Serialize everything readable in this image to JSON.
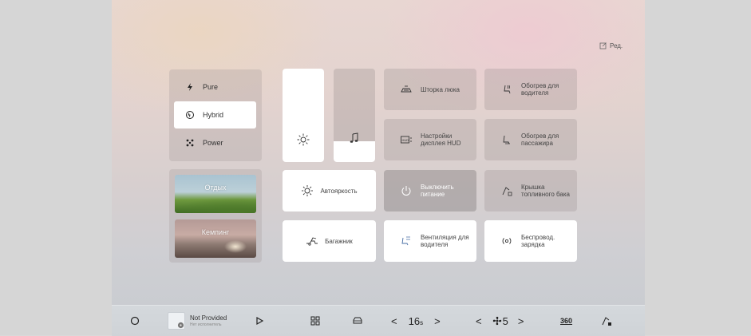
{
  "edit_label": "Ред.",
  "modes": [
    {
      "label": "Pure",
      "icon": "lightning-icon",
      "active": false
    },
    {
      "label": "Hybrid",
      "icon": "hybrid-cycle-icon",
      "active": true
    },
    {
      "label": "Power",
      "icon": "power-mode-icon",
      "active": false
    }
  ],
  "scenes": [
    {
      "label": "Отдых"
    },
    {
      "label": "Кемпинг"
    }
  ],
  "sliders": {
    "brightness": {
      "icon": "brightness-icon",
      "level": 1.0
    },
    "volume": {
      "icon": "music-note-icon",
      "level": 0.22
    }
  },
  "quick_tiles": {
    "auto_brightness": "Автояркость",
    "trunk": "Багажник"
  },
  "grid_tiles": [
    {
      "label": "Шторка люка",
      "icon": "sunroof-shade-icon",
      "style": "grey"
    },
    {
      "label": "Обогрев для водителя",
      "icon": "seat-heat-icon",
      "style": "grey"
    },
    {
      "label": "Настройки дисплея HUD",
      "icon": "hud-icon",
      "style": "grey"
    },
    {
      "label": "Обогрев для пассажира",
      "icon": "seat-heat-icon",
      "style": "grey"
    },
    {
      "label": "Выключить питание",
      "icon": "power-icon",
      "style": "dark"
    },
    {
      "label": "Крышка топливного бака",
      "icon": "fuel-door-icon",
      "style": "grey"
    },
    {
      "label": "Вентиляция для водителя",
      "icon": "seat-vent-icon",
      "style": "white"
    },
    {
      "label": "Беспровод. зарядка",
      "icon": "wireless-charge-icon",
      "style": "white"
    }
  ],
  "bottom_bar": {
    "media_title": "Not Provided",
    "media_subtitle": "Нет исполнитель",
    "temp_value": "16",
    "temp_unit": "s",
    "fan_value": "5",
    "view_360_label": "360"
  }
}
